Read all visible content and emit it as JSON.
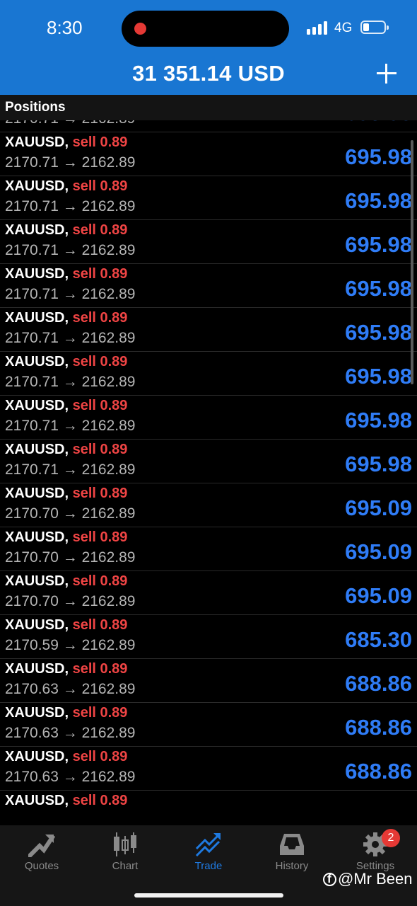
{
  "status_bar": {
    "time": "8:30",
    "network": "4G"
  },
  "header": {
    "balance": "31 351.14 USD"
  },
  "positions": {
    "title": "Positions",
    "rows": [
      {
        "symbol": "XAUUSD,",
        "side": "sell 0.89",
        "prices": "2170.71 → 2162.89",
        "profit": "695.98"
      },
      {
        "symbol": "XAUUSD,",
        "side": "sell 0.89",
        "prices": "2170.71 → 2162.89",
        "profit": "695.98"
      },
      {
        "symbol": "XAUUSD,",
        "side": "sell 0.89",
        "prices": "2170.71 → 2162.89",
        "profit": "695.98"
      },
      {
        "symbol": "XAUUSD,",
        "side": "sell 0.89",
        "prices": "2170.71 → 2162.89",
        "profit": "695.98"
      },
      {
        "symbol": "XAUUSD,",
        "side": "sell 0.89",
        "prices": "2170.71 → 2162.89",
        "profit": "695.98"
      },
      {
        "symbol": "XAUUSD,",
        "side": "sell 0.89",
        "prices": "2170.71 → 2162.89",
        "profit": "695.98"
      },
      {
        "symbol": "XAUUSD,",
        "side": "sell 0.89",
        "prices": "2170.71 → 2162.89",
        "profit": "695.98"
      },
      {
        "symbol": "XAUUSD,",
        "side": "sell 0.89",
        "prices": "2170.71 → 2162.89",
        "profit": "695.98"
      },
      {
        "symbol": "XAUUSD,",
        "side": "sell 0.89",
        "prices": "2170.71 → 2162.89",
        "profit": "695.98"
      },
      {
        "symbol": "XAUUSD,",
        "side": "sell 0.89",
        "prices": "2170.70 → 2162.89",
        "profit": "695.09"
      },
      {
        "symbol": "XAUUSD,",
        "side": "sell 0.89",
        "prices": "2170.70 → 2162.89",
        "profit": "695.09"
      },
      {
        "symbol": "XAUUSD,",
        "side": "sell 0.89",
        "prices": "2170.70 → 2162.89",
        "profit": "695.09"
      },
      {
        "symbol": "XAUUSD,",
        "side": "sell 0.89",
        "prices": "2170.59 → 2162.89",
        "profit": "685.30"
      },
      {
        "symbol": "XAUUSD,",
        "side": "sell 0.89",
        "prices": "2170.63 → 2162.89",
        "profit": "688.86"
      },
      {
        "symbol": "XAUUSD,",
        "side": "sell 0.89",
        "prices": "2170.63 → 2162.89",
        "profit": "688.86"
      },
      {
        "symbol": "XAUUSD,",
        "side": "sell 0.89",
        "prices": "2170.63 → 2162.89",
        "profit": "688.86"
      },
      {
        "symbol": "XAUUSD,",
        "side": "sell 0.89",
        "prices": "",
        "profit": ""
      }
    ]
  },
  "tabs": [
    {
      "label": "Quotes",
      "icon": "quotes-icon"
    },
    {
      "label": "Chart",
      "icon": "chart-icon"
    },
    {
      "label": "Trade",
      "icon": "trade-icon",
      "active": true
    },
    {
      "label": "History",
      "icon": "history-icon"
    },
    {
      "label": "Settings",
      "icon": "settings-icon",
      "badge": "2"
    }
  ],
  "watermark": "@Mr Been",
  "colors": {
    "header": "#1976d2",
    "sell": "#ef4444",
    "profit": "#2f7cf6",
    "active_tab": "#1f7ae0"
  }
}
